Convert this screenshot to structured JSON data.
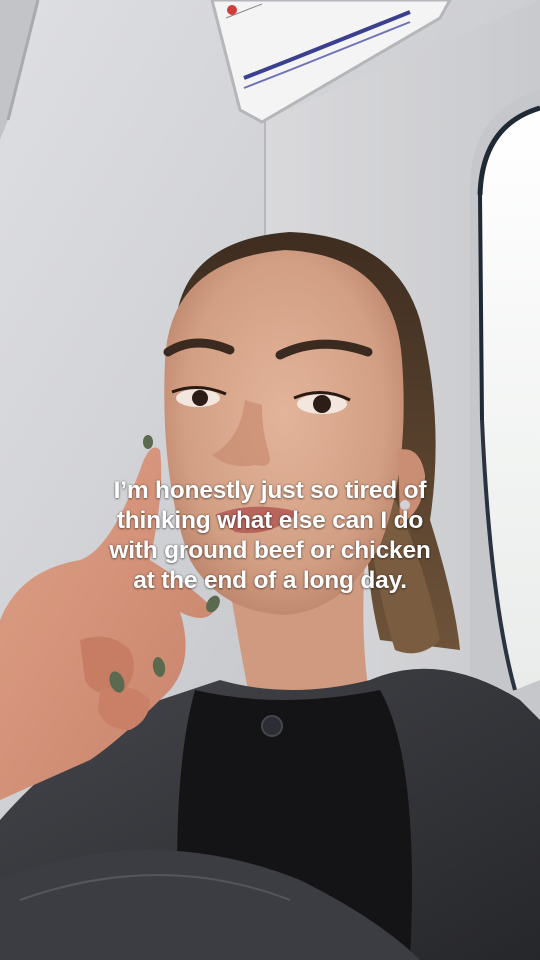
{
  "caption": {
    "lines": [
      "I’m honestly just so tired of",
      "thinking what else can I do",
      "with ground beef or chicken",
      "at the end of a long day."
    ]
  },
  "scene": {
    "description_icon": "selfie-photo",
    "colors": {
      "wall": "#d4d5d9",
      "window_light": "#f3f5f4",
      "hair": "#5b4330",
      "skin": "#d9a98c",
      "sweater": "#151517",
      "jacket": "#34353a",
      "caption_text": "#ffffff"
    }
  }
}
